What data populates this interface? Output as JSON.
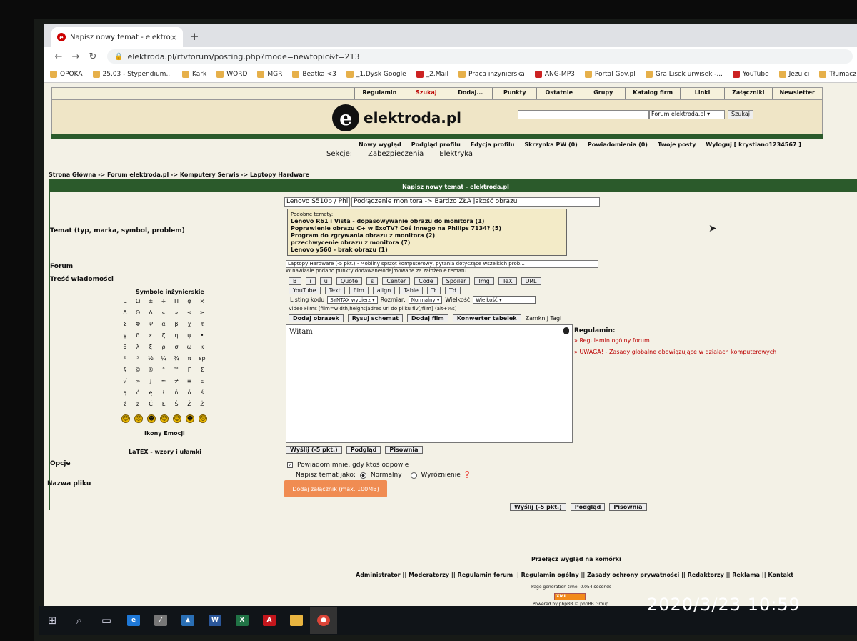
{
  "browser": {
    "tab_title": "Napisz nowy temat - elektroda.pl",
    "tab_close": "×",
    "new_tab": "+",
    "url": "elektroda.pl/rtvforum/posting.php?mode=newtopic&f=213",
    "bookmarks": [
      "OPOKA",
      "25.03 - Stypendium...",
      "Kark",
      "WORD",
      "MGR",
      "Beatka <3",
      "_1.Dysk Google",
      "_2.Mail",
      "Praca inżynierska",
      "ANG-MP3",
      "Portal Gov.pl",
      "Gra Lisek urwisek -...",
      "YouTube",
      "Jezuici",
      "Tłumacz"
    ]
  },
  "site": {
    "top_menu": [
      "Regulamin",
      "Szukaj",
      "Dodaj...",
      "Punkty",
      "Ostatnie",
      "Grupy",
      "Katalog firm",
      "Linki",
      "Załączniki",
      "Newsletter"
    ],
    "logo_letter": "e",
    "logo_name": "elektroda.pl",
    "search_scope": "Forum elektroda.pl ▾",
    "search_button": "Szukaj",
    "user_menu": [
      "Nowy wygląd",
      "Podgląd profilu",
      "Edycja profilu",
      "Skrzynka PW (0)",
      "Powiadomienia (0)",
      "Twoje posty",
      "Wyloguj [ krystiano1234567 ]"
    ],
    "sekcje_label": "Sekcje:",
    "sekcje": [
      "Zabezpieczenia",
      "Elektryka"
    ],
    "breadcrumb": "Strona Główna -> Forum elektroda.pl -> Komputery Serwis -> Laptopy Hardware"
  },
  "form": {
    "title": "Napisz nowy temat - elektroda.pl",
    "topic_label": "Temat (typ, marka, symbol, problem)",
    "topic_model": "Lenovo S510p / Phi",
    "topic_text": "Podłączenie monitora -> Bardzo ZŁA jakość obrazu",
    "similar_header": "Podobne tematy:",
    "similar": [
      "Lenovo R61 i Vista - dopasowywanie obrazu do monitora (1)",
      "Poprawienie obrazu C+ w ExoTV? Coś innego na Philips 7134? (5)",
      "Program do zgrywania obrazu z monitora (2)",
      "przechwycenie obrazu z monitora (7)",
      "Lenovo y560 - brak obrazu (1)"
    ],
    "forum_label": "Forum",
    "forum_value": "Laptopy Hardware (-5 pkt.) - Mobilny sprzęt komputerowy, pytania dotyczące wszelkich prob...",
    "forum_note": "W nawiasie podano punkty dodawane/odejmowane za założenie tematu",
    "content_label": "Treść wiadomości",
    "toolbar_row1": [
      "B",
      "i",
      "u",
      "Quote",
      "s",
      "Center",
      "Code",
      "Spoiler",
      "Img",
      "TeX",
      "URL"
    ],
    "toolbar_row2": [
      "YouTube",
      "Text",
      "film",
      "align",
      "Table",
      "Tr",
      "Td"
    ],
    "listing_label": "Listing kodu",
    "listing_value": "SYNTAX wybierz ▾",
    "size_label": "Rozmiar:",
    "size_value": "Normalny ▾",
    "wielkosc_label": "Wielkość",
    "wielkosc_value": "Wielkość ▾",
    "video_note": "Video Films [film=width,height]adres url do pliku flv[/film] (alt+%s)",
    "toolbar_row3": [
      "Dodaj obrazek",
      "Rysuj schemat",
      "Dodaj film",
      "Konwerter tabelek"
    ],
    "close_tags": "Zamknij Tagi",
    "message": "Witam",
    "symbols_title": "Symbole inżynierskie",
    "symbols": [
      "μ",
      "Ω",
      "±",
      "÷",
      "Π",
      "φ",
      "×",
      "Δ",
      "Θ",
      "Λ",
      "«",
      "»",
      "≤",
      "≥",
      "Σ",
      "Φ",
      "Ψ",
      "α",
      "β",
      "χ",
      "τ",
      "γ",
      "δ",
      "ε",
      "ζ",
      "η",
      "ψ",
      "•",
      "θ",
      "λ",
      "ξ",
      "ρ",
      "σ",
      "ω",
      "κ",
      "²",
      "³",
      "½",
      "¼",
      "¾",
      "π",
      "sp",
      "§",
      "©",
      "®",
      "°",
      "™",
      "Γ",
      "Σ",
      "√",
      "∞",
      "∫",
      "≈",
      "≠",
      "≡",
      "Ξ",
      "ą",
      "ć",
      "ę",
      "ł",
      "ń",
      "ó",
      "ś",
      "ź",
      "ż",
      "Ć",
      "Ł",
      "Ś",
      "Ź",
      "Ż"
    ],
    "emoticons": [
      "☺",
      "☹",
      "☻",
      "☺",
      "☺",
      "☻",
      "☹"
    ],
    "emoticons_label": "Ikony Emocji",
    "latex_label": "LaTEX - wzory i ułamki",
    "submit_buttons": [
      "Wyślij (-5 pkt.)",
      "Podgląd",
      "Pisownia"
    ],
    "rules_title": "Regulamin:",
    "rules": [
      "» Regulamin ogólny forum",
      "» UWAGA! - Zasady globalne obowiązujące w działach komputerowych"
    ],
    "options_label": "Opcje",
    "notify_label": "Powiadom mnie, gdy ktoś odpowie",
    "post_as_label": "Napisz temat jako:",
    "post_as_normal": "Normalny",
    "post_as_highlight": "Wyróżnienie",
    "filename_label": "Nazwa pliku",
    "attach_button": "Dodaj załącznik (max. 100MB)"
  },
  "footer": {
    "switch": "Przełącz wygląd na komórki",
    "links": "Administrator || Moderatorzy || Regulamin forum || Regulamin ogólny || Zasady ochrony prywatności || Redaktorzy || Reklama || Kontakt",
    "gen_time": "Page generation time: 0.054 seconds",
    "xml": "XML",
    "powered": "Powered by phpBB © phpBB Group"
  },
  "photo_timestamp": "2020/3/23  10:59",
  "colors": {
    "forum_green": "#2b5a2b",
    "attach_orange": "#f08c52",
    "rules_red": "#b00000"
  }
}
